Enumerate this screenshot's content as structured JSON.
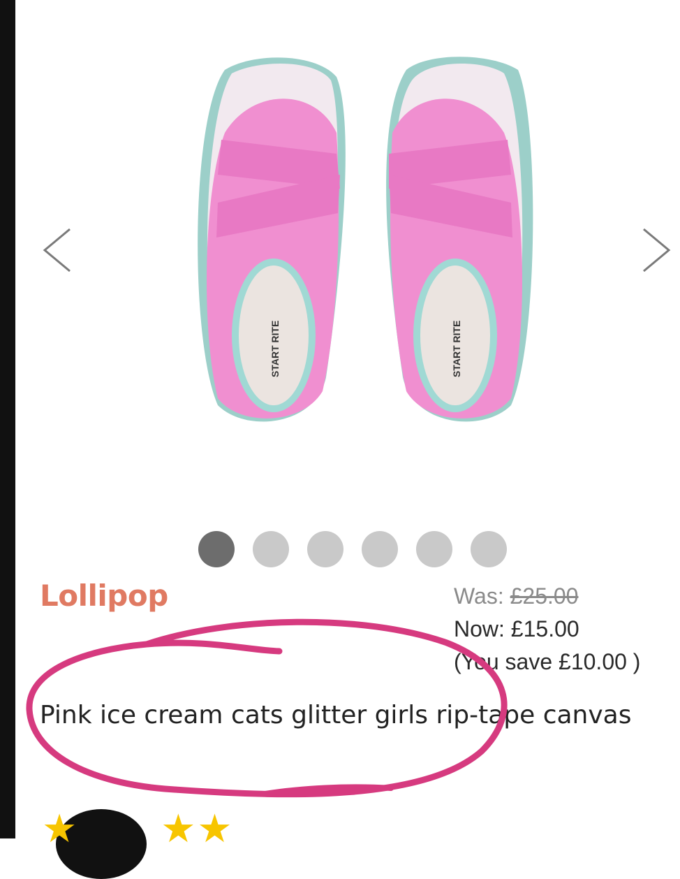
{
  "gallery": {
    "prev_icon": "chevron-left-icon",
    "next_icon": "chevron-right-icon",
    "image_alt": "pink canvas shoes",
    "shoe_brand_text": "START RITE",
    "dot_count": 6,
    "active_dot": 1
  },
  "product": {
    "brand": "Lollipop",
    "was_label": "Was: ",
    "was_price": "£25.00",
    "now_label": "Now: £15.00",
    "save_label": "(You save £10.00 )",
    "title": "Pink ice cream cats glitter girls rip-tape canvas"
  },
  "rating": {
    "stars_shown": 3,
    "icon": "star-icon"
  },
  "colors": {
    "brand": "#e07a62",
    "shoe_pink": "#f08fd0",
    "annotation": "#d63a7f",
    "star": "#f7c500"
  }
}
